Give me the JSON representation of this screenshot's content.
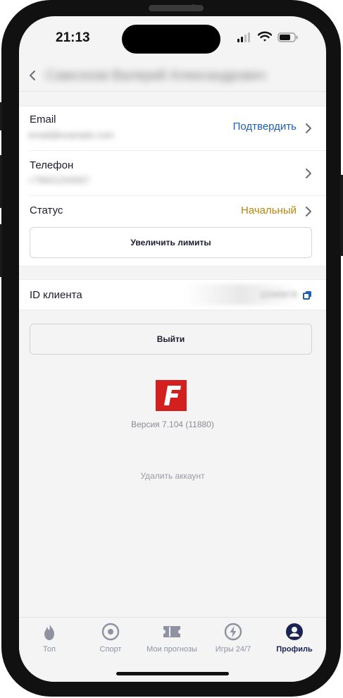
{
  "status_bar": {
    "time": "21:13"
  },
  "header": {
    "title": "Самсонов Валерий Александрович"
  },
  "profile": {
    "email": {
      "label": "Email",
      "value": "email@example.com",
      "action": "Подтвердить"
    },
    "phone": {
      "label": "Телефон",
      "value": "+79001234567"
    },
    "status": {
      "label": "Статус",
      "value": "Начальный"
    },
    "increase_limits_label": "Увеличить лимиты",
    "client_id": {
      "label": "ID клиента",
      "value": "12345678"
    }
  },
  "logout_label": "Выйти",
  "logo": {
    "letter": "F"
  },
  "version_text": "Версия 7.104 (11880)",
  "delete_account_label": "Удалить аккаунт",
  "bottom_nav": [
    {
      "label": "Топ",
      "icon": "flame-icon",
      "active": false
    },
    {
      "label": "Спорт",
      "icon": "target-icon",
      "active": false
    },
    {
      "label": "Мои прогнозы",
      "icon": "ticket-icon",
      "active": false
    },
    {
      "label": "Игры 24/7",
      "icon": "lightning-icon",
      "active": false
    },
    {
      "label": "Профиль",
      "icon": "user-icon",
      "active": true
    }
  ],
  "colors": {
    "accent_blue": "#1f5fb5",
    "status_gold": "#b8860b",
    "nav_active": "#1b2352",
    "nav_inactive": "#8f92a1",
    "logo_red": "#d41f1f"
  }
}
